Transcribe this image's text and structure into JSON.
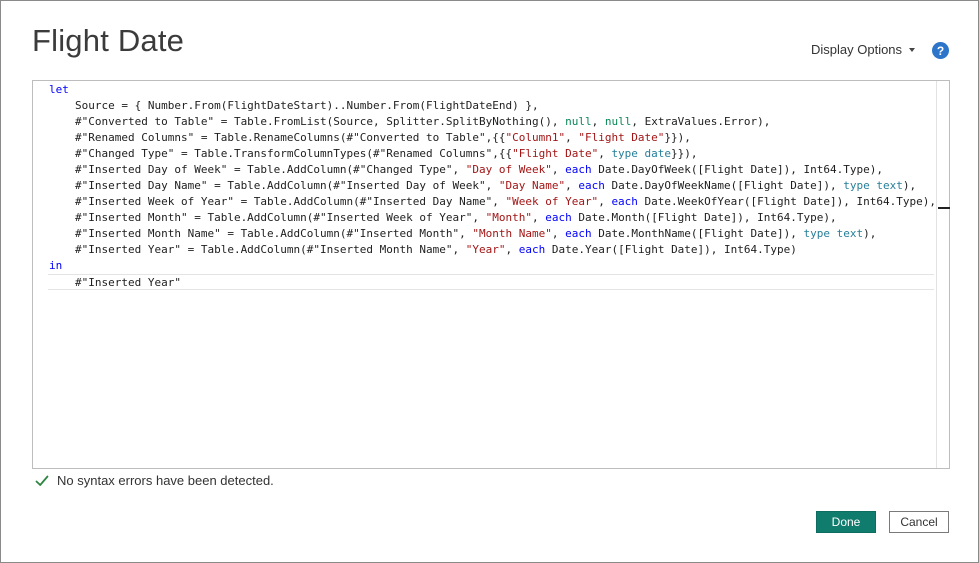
{
  "dialog": {
    "title": "Flight Date",
    "display_options_label": "Display Options",
    "help_label": "?"
  },
  "editor": {
    "lines": [
      [
        {
          "t": "let",
          "c": "kw"
        }
      ],
      [
        {
          "t": "Source = { Number.From(FlightDateStart)..Number.From(FlightDateEnd) },",
          "c": ""
        }
      ],
      [
        {
          "t": "#\"Converted to Table\" = Table.FromList(Source, Splitter.SplitByNothing(), ",
          "c": ""
        },
        {
          "t": "null",
          "c": "null"
        },
        {
          "t": ", ",
          "c": ""
        },
        {
          "t": "null",
          "c": "null"
        },
        {
          "t": ", ExtraValues.Error),",
          "c": ""
        }
      ],
      [
        {
          "t": "#\"Renamed Columns\" = Table.RenameColumns(#\"Converted to Table\",{{",
          "c": ""
        },
        {
          "t": "\"Column1\"",
          "c": "str"
        },
        {
          "t": ", ",
          "c": ""
        },
        {
          "t": "\"Flight Date\"",
          "c": "str"
        },
        {
          "t": "}}),",
          "c": ""
        }
      ],
      [
        {
          "t": "#\"Changed Type\" = Table.TransformColumnTypes(#\"Renamed Columns\",{{",
          "c": ""
        },
        {
          "t": "\"Flight Date\"",
          "c": "str"
        },
        {
          "t": ", ",
          "c": ""
        },
        {
          "t": "type date",
          "c": "typ"
        },
        {
          "t": "}}),",
          "c": ""
        }
      ],
      [
        {
          "t": "#\"Inserted Day of Week\" = Table.AddColumn(#\"Changed Type\", ",
          "c": ""
        },
        {
          "t": "\"Day of Week\"",
          "c": "str"
        },
        {
          "t": ", ",
          "c": ""
        },
        {
          "t": "each",
          "c": "kw"
        },
        {
          "t": " Date.DayOfWeek([Flight Date]), Int64.Type),",
          "c": ""
        }
      ],
      [
        {
          "t": "#\"Inserted Day Name\" = Table.AddColumn(#\"Inserted Day of Week\", ",
          "c": ""
        },
        {
          "t": "\"Day Name\"",
          "c": "str"
        },
        {
          "t": ", ",
          "c": ""
        },
        {
          "t": "each",
          "c": "kw"
        },
        {
          "t": " Date.DayOfWeekName([Flight Date]), ",
          "c": ""
        },
        {
          "t": "type text",
          "c": "typ"
        },
        {
          "t": "),",
          "c": ""
        }
      ],
      [
        {
          "t": "#\"Inserted Week of Year\" = Table.AddColumn(#\"Inserted Day Name\", ",
          "c": ""
        },
        {
          "t": "\"Week of Year\"",
          "c": "str"
        },
        {
          "t": ", ",
          "c": ""
        },
        {
          "t": "each",
          "c": "kw"
        },
        {
          "t": " Date.WeekOfYear([Flight Date]), Int64.Type),",
          "c": ""
        }
      ],
      [
        {
          "t": "#\"Inserted Month\" = Table.AddColumn(#\"Inserted Week of Year\", ",
          "c": ""
        },
        {
          "t": "\"Month\"",
          "c": "str"
        },
        {
          "t": ", ",
          "c": ""
        },
        {
          "t": "each",
          "c": "kw"
        },
        {
          "t": " Date.Month([Flight Date]), Int64.Type),",
          "c": ""
        }
      ],
      [
        {
          "t": "#\"Inserted Month Name\" = Table.AddColumn(#\"Inserted Month\", ",
          "c": ""
        },
        {
          "t": "\"Month Name\"",
          "c": "str"
        },
        {
          "t": ", ",
          "c": ""
        },
        {
          "t": "each",
          "c": "kw"
        },
        {
          "t": " Date.MonthName([Flight Date]), ",
          "c": ""
        },
        {
          "t": "type text",
          "c": "typ"
        },
        {
          "t": "),",
          "c": ""
        }
      ],
      [
        {
          "t": "#\"Inserted Year\" = Table.AddColumn(#\"Inserted Month Name\", ",
          "c": ""
        },
        {
          "t": "\"Year\"",
          "c": "str"
        },
        {
          "t": ", ",
          "c": ""
        },
        {
          "t": "each",
          "c": "kw"
        },
        {
          "t": " Date.Year([Flight Date]), Int64.Type)",
          "c": ""
        }
      ],
      [
        {
          "t": "in",
          "c": "kw"
        }
      ],
      [
        {
          "t": "#\"Inserted Year\"",
          "c": ""
        }
      ]
    ],
    "indented": [
      false,
      true,
      true,
      true,
      true,
      true,
      true,
      true,
      true,
      true,
      true,
      false,
      true
    ],
    "current_line": 12
  },
  "status": {
    "message": "No syntax errors have been detected."
  },
  "buttons": {
    "done_label": "Done",
    "cancel_label": "Cancel"
  },
  "colors": {
    "accent": "#107c6d",
    "keyword": "#0000ff",
    "string": "#a31515",
    "type": "#267f99",
    "null_literal": "#098658",
    "success": "#2e8540",
    "help": "#2c75c9"
  }
}
